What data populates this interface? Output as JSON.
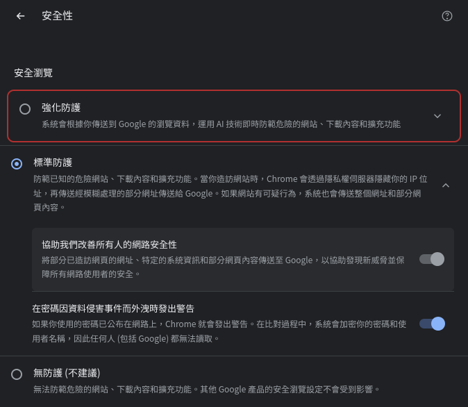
{
  "header": {
    "title": "安全性"
  },
  "section_label": "安全瀏覽",
  "options": {
    "enhanced": {
      "title": "強化防護",
      "desc": "系統會根據你傳送到 Google 的瀏覽資料，運用 AI 技術即時防範危險的網站、下載內容和擴充功能"
    },
    "standard": {
      "title": "標準防護",
      "desc": "防範已知的危險網站、下載內容和擴充功能。當你造訪網站時，Chrome 會透過隱私權伺服器隱藏你的 IP 位址，再傳送經模糊處理的部分網址傳送給 Google。如果網站有可疑行為，系統也會傳送整個網址和部分網頁內容。"
    },
    "none": {
      "title": "無防護 (不建議)",
      "desc": "無法防範危險的網站、下載內容和擴充功能。其他 Google 產品的安全瀏覽設定不會受到影響。"
    }
  },
  "standard_sub": {
    "improve": {
      "title": "協助我們改善所有人的網路安全性",
      "desc": "將部分已造訪網頁的網址、特定的系統資訊和部分網頁內容傳送至 Google，以協助發現新威脅並保障所有網路使用者的安全。"
    },
    "password_warn": {
      "title": "在密碼因資料侵害事件而外洩時發出警告",
      "desc": "如果你使用的密碼已公布在網路上，Chrome 就會發出警告。在比對過程中，系統會加密你的密碼和使用者名稱，因此任何人 (包括 Google) 都無法讀取。"
    }
  }
}
